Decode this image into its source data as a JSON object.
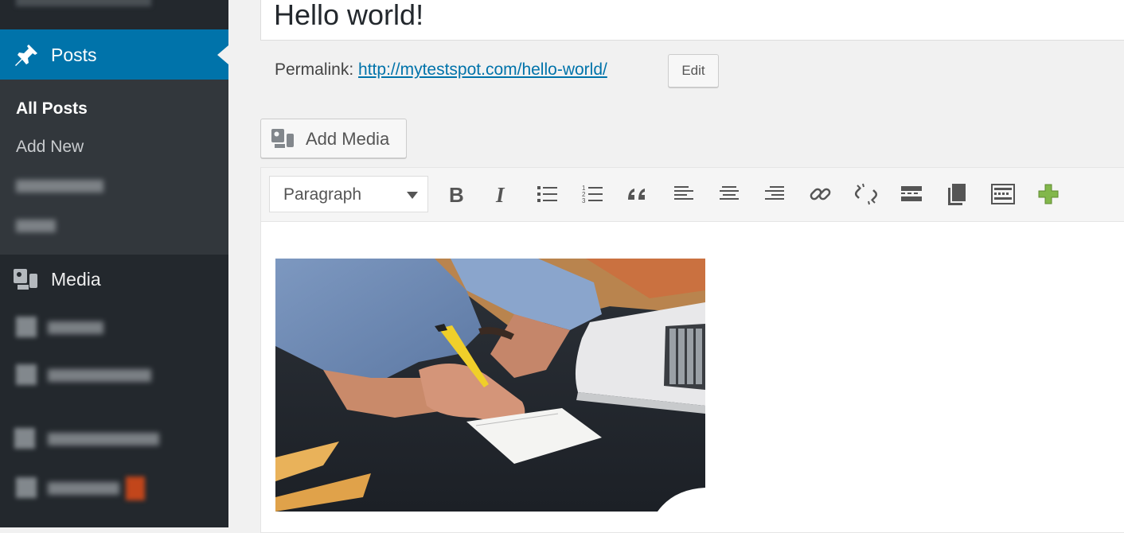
{
  "sidebar": {
    "posts_label": "Posts",
    "submenu": [
      "All Posts",
      "Add New"
    ],
    "media_label": "Media"
  },
  "post": {
    "title": "Hello world!",
    "permalink_label": "Permalink:",
    "permalink_url": "http://mytestspot.com/hello-world/",
    "edit_label": "Edit",
    "add_media_label": "Add Media"
  },
  "toolbar": {
    "format_select": "Paragraph",
    "buttons": [
      "bold-icon",
      "italic-icon",
      "bulleted-list-icon",
      "numbered-list-icon",
      "blockquote-icon",
      "align-left-icon",
      "align-center-icon",
      "align-right-icon",
      "insert-link-icon",
      "remove-link-icon",
      "read-more-icon",
      "paste-icon",
      "toolbar-toggle-icon",
      "plugin-add-icon"
    ]
  },
  "colors": {
    "admin_bar": "#23282d",
    "accent": "#0073aa",
    "submenu_bg": "#32373c",
    "plugin_icon": "#82b74b"
  }
}
